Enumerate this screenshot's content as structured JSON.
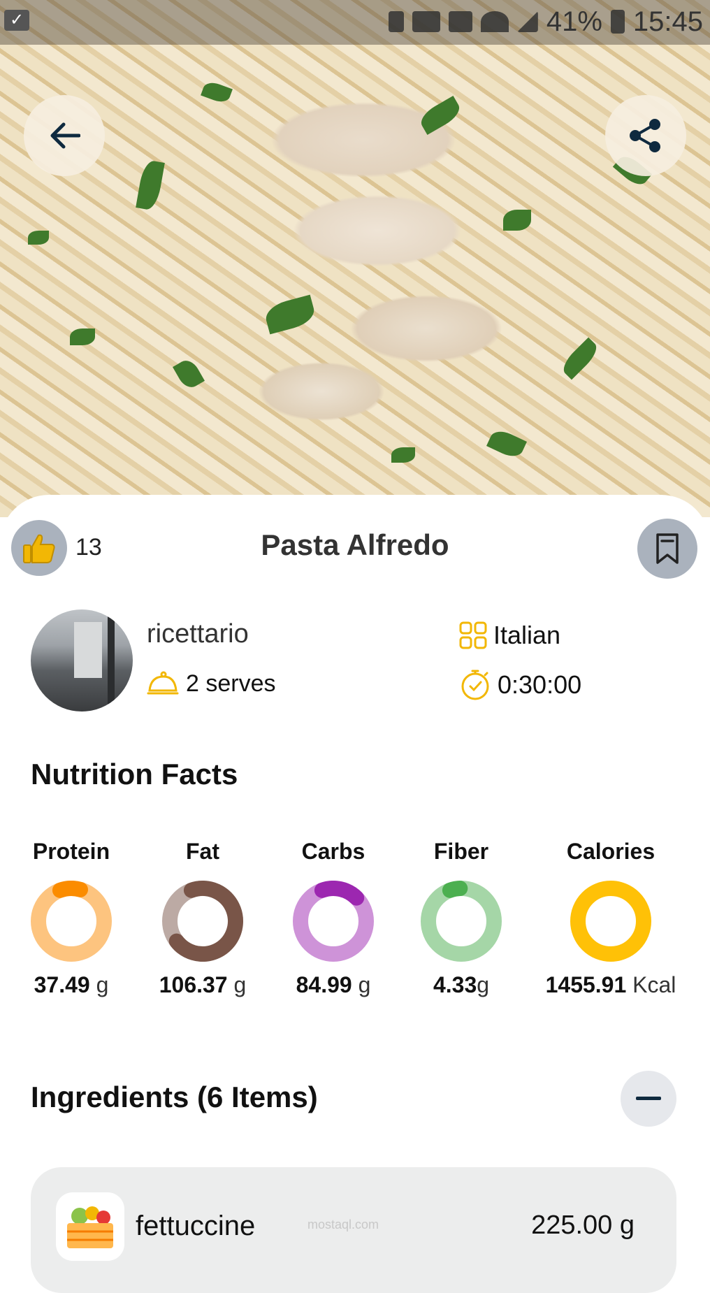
{
  "status_bar": {
    "battery": "41%",
    "time": "15:45"
  },
  "recipe": {
    "likes": "13",
    "title": "Pasta Alfredo",
    "author": "ricettario",
    "serves": "2 serves",
    "cuisine": "Italian",
    "time": "0:30:00"
  },
  "nutrition": {
    "heading": "Nutrition Facts",
    "items": [
      {
        "label": "Protein",
        "value": "37.49",
        "unit": "g",
        "fraction": 0.1,
        "ring": "#fdc47f",
        "arc": "#fb8c00"
      },
      {
        "label": "Fat",
        "value": "106.37",
        "unit": "g",
        "fraction": 0.7,
        "ring": "#bcaaa4",
        "arc": "#795548"
      },
      {
        "label": "Carbs",
        "value": "84.99",
        "unit": "g",
        "fraction": 0.18,
        "ring": "#ce93d8",
        "arc": "#9c27b0"
      },
      {
        "label": "Fiber",
        "value": "4.33",
        "unit": "g",
        "fraction": 0.05,
        "ring": "#a5d6a7",
        "arc": "#4caf50"
      },
      {
        "label": "Calories",
        "value": "1455.91",
        "unit": "Kcal",
        "fraction": 0.0,
        "ring": "#ffc107",
        "arc": "#ffc107"
      }
    ]
  },
  "ingredients": {
    "heading": "Ingredients (6 Items)",
    "items": [
      {
        "name": "fettuccine",
        "qty": "225.00 g"
      }
    ]
  },
  "watermark": "mostaql.com",
  "icons": {
    "back": "arrow-left-icon",
    "share": "share-icon",
    "like": "thumbs-up-icon",
    "bookmark": "bookmark-icon",
    "serves": "cloche-icon",
    "cuisine": "grid-icon",
    "time": "stopwatch-icon",
    "collapse": "minus-icon",
    "ingredient": "produce-crate-icon"
  },
  "colors": {
    "accent": "#f2b705",
    "button_gray": "#aab2bd"
  }
}
